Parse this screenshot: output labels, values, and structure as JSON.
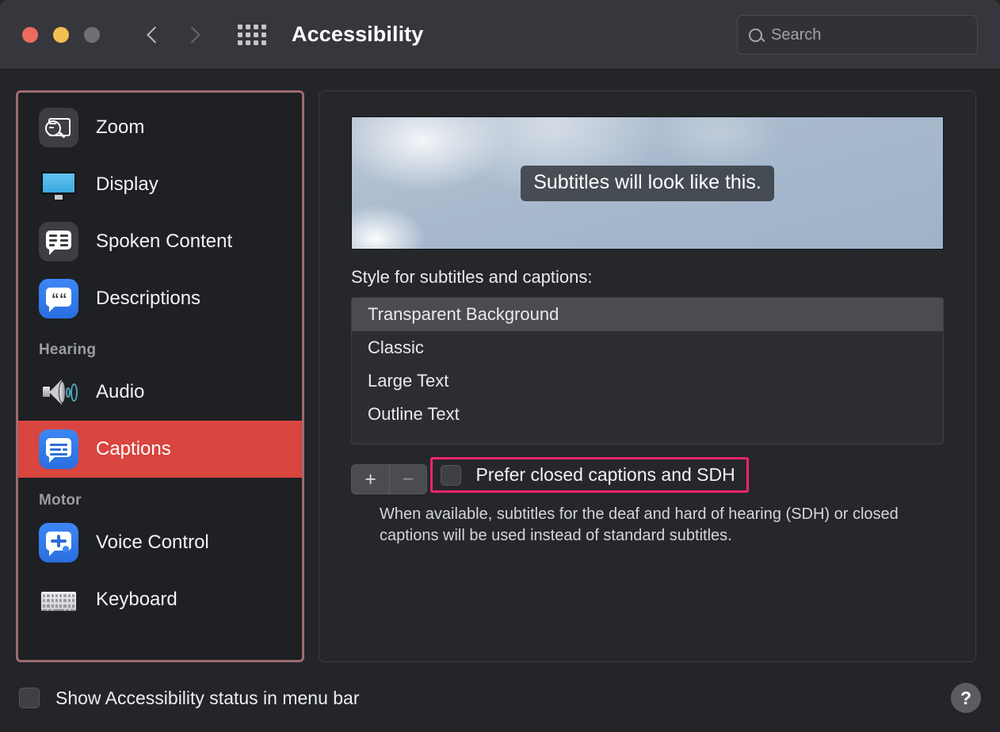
{
  "window": {
    "title": "Accessibility",
    "traffic_lights": [
      "close",
      "minimize",
      "zoom"
    ],
    "back_label": "Back",
    "forward_label": "Forward",
    "showall_label": "Show All"
  },
  "search": {
    "placeholder": "Search",
    "value": "",
    "icon": "search-icon"
  },
  "sidebar": {
    "highlight_color": "#9e6b71",
    "selected_color": "#d9453f",
    "items": [
      {
        "label": "Zoom",
        "icon": "zoom-icon",
        "selected": false,
        "group": null
      },
      {
        "label": "Display",
        "icon": "display-icon",
        "selected": false,
        "group": null
      },
      {
        "label": "Spoken Content",
        "icon": "spoken-content-icon",
        "selected": false,
        "group": null
      },
      {
        "label": "Descriptions",
        "icon": "descriptions-icon",
        "selected": false,
        "group": null
      }
    ],
    "groups": [
      {
        "title": "Hearing",
        "items": [
          {
            "label": "Audio",
            "icon": "audio-icon",
            "selected": false
          },
          {
            "label": "Captions",
            "icon": "captions-icon",
            "selected": true
          }
        ]
      },
      {
        "title": "Motor",
        "items": [
          {
            "label": "Voice Control",
            "icon": "voice-control-icon",
            "selected": false
          },
          {
            "label": "Keyboard",
            "icon": "keyboard-icon",
            "selected": false
          }
        ]
      }
    ]
  },
  "main": {
    "preview": {
      "caption_text": "Subtitles will look like this.",
      "background": "sky-with-clouds"
    },
    "style_label": "Style for subtitles and captions:",
    "styles": [
      {
        "label": "Transparent Background",
        "selected": true
      },
      {
        "label": "Classic",
        "selected": false
      },
      {
        "label": "Large Text",
        "selected": false
      },
      {
        "label": "Outline Text",
        "selected": false
      }
    ],
    "add_button": "+",
    "remove_button": "−",
    "prefer_cc": {
      "label": "Prefer closed captions and SDH",
      "checked": false,
      "highlight_color": "#f7246e"
    },
    "prefer_cc_description": "When available, subtitles for the deaf and hard of hearing (SDH) or closed captions will be used instead of standard subtitles."
  },
  "footer": {
    "menubar_checkbox_label": "Show Accessibility status in menu bar",
    "menubar_checked": false,
    "help_label": "?"
  }
}
